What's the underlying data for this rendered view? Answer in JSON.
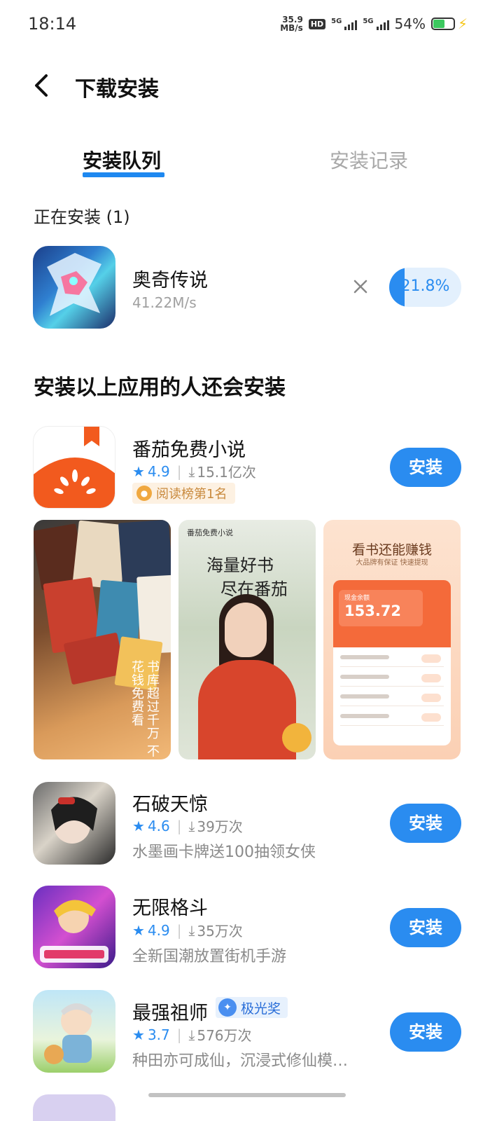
{
  "status_bar": {
    "time": "18:14",
    "speed_value": "35.9",
    "speed_unit": "MB/s",
    "hd_label": "HD",
    "network1": "5G",
    "network2": "5G",
    "battery": "54%"
  },
  "header": {
    "title": "下载安装"
  },
  "tabs": [
    {
      "label": "安装队列",
      "active": true
    },
    {
      "label": "安装记录",
      "active": false
    }
  ],
  "installing": {
    "section_label": "正在安装 (1)",
    "app": {
      "name": "奥奇传说",
      "speed": "41.22M/s",
      "progress_text": "21.8%",
      "progress": 0.218
    }
  },
  "recommend": {
    "heading": "安装以上应用的人还会安装",
    "install_label": "安装",
    "apps": [
      {
        "name": "番茄免费小说",
        "rating": "4.9",
        "downloads": "15.1亿次",
        "badge": "阅读榜第1名",
        "screenshots": {
          "s1_text": "书库超过千万 不花钱免费看",
          "s2_logo": "番茄免费小说",
          "s2_slogan_1": "海量好书",
          "s2_slogan_2": "尽在番茄",
          "s3_title": "看书还能赚钱",
          "s3_sub": "大品牌有保证 快速提现",
          "s3_cash_label": "现金余额",
          "s3_cash_value": "153.72"
        }
      },
      {
        "name": "石破天惊",
        "rating": "4.6",
        "downloads": "39万次",
        "desc": "水墨画卡牌送100抽领女侠"
      },
      {
        "name": "无限格斗",
        "rating": "4.9",
        "downloads": "35万次",
        "desc": "全新国潮放置街机手游"
      },
      {
        "name": "最强祖师",
        "rating": "3.7",
        "downloads": "576万次",
        "desc": "种田亦可成仙，沉浸式修仙模…",
        "award": "极光奖"
      }
    ]
  },
  "colors": {
    "accent": "#2a8cf0",
    "progress_bg": "#e3f0fd"
  }
}
